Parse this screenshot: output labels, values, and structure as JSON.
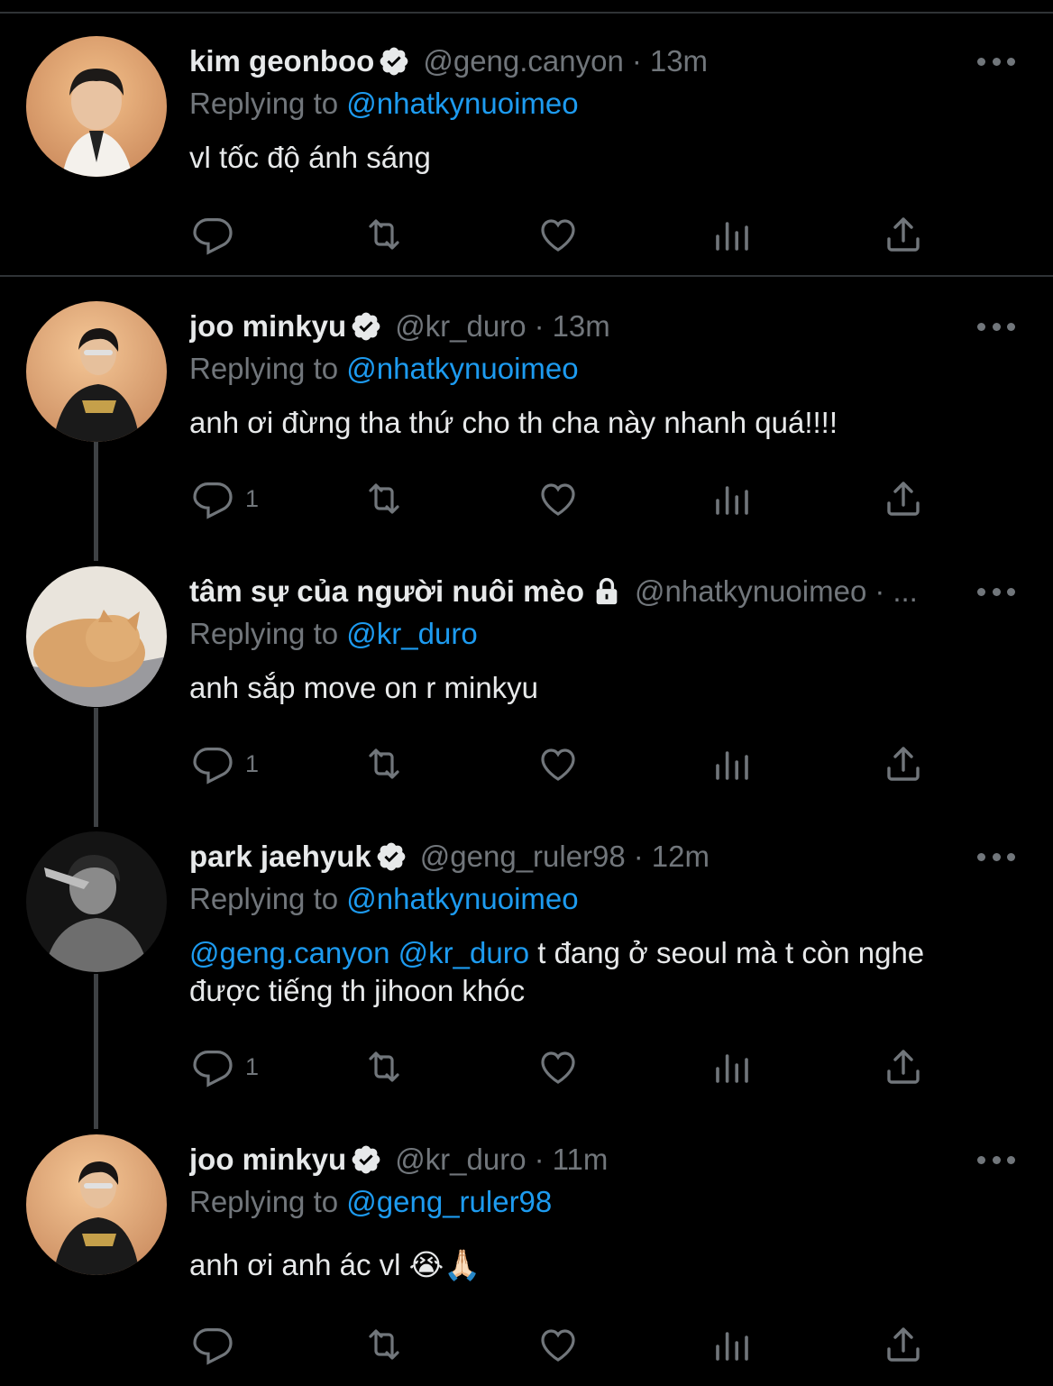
{
  "colors": {
    "background": "#000000",
    "text": "#e7e9ea",
    "muted": "#71767b",
    "link": "#1d9bf0",
    "badge": "#e7e9ea",
    "divider": "#2f3336"
  },
  "replying_prefix": "Replying to",
  "tweets": [
    {
      "name": "kim geonboo",
      "verified": true,
      "handle": "@geng.canyon",
      "separator": "·",
      "time": "13m",
      "replying_to": "@nhatkynuoimeo",
      "text": "vl tốc độ ánh sáng",
      "reply_count": ""
    },
    {
      "name": "joo minkyu",
      "verified": true,
      "handle": "@kr_duro",
      "separator": "·",
      "time": "13m",
      "replying_to": "@nhatkynuoimeo",
      "text": "anh ơi đừng tha thứ cho th cha này nhanh quá!!!!",
      "reply_count": "1"
    },
    {
      "name": "tâm sự của người nuôi mèo",
      "protected": true,
      "handle": "@nhatkynuoimeo",
      "separator": "·",
      "time": "...",
      "replying_to": "@kr_duro",
      "text": "anh sắp move on r minkyu",
      "reply_count": "1"
    },
    {
      "name": "park jaehyuk",
      "verified": true,
      "handle": "@geng_ruler98",
      "separator": "·",
      "time": "12m",
      "replying_to": "@nhatkynuoimeo",
      "mention_1": "@geng.canyon",
      "mention_2": "@kr_duro",
      "text": "t đang ở seoul mà t còn nghe được tiếng th jihoon khóc",
      "reply_count": "1"
    },
    {
      "name": "joo minkyu",
      "verified": true,
      "handle": "@kr_duro",
      "separator": "·",
      "time": "11m",
      "replying_to": "@geng_ruler98",
      "text": "anh ơi anh ác vl 😭🙏🏻",
      "reply_count": ""
    }
  ]
}
